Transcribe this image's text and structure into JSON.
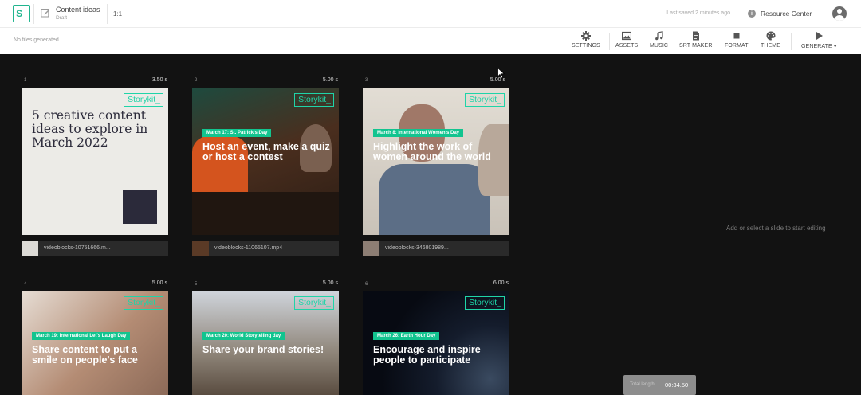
{
  "app": {
    "logo": "S_",
    "project_title": "Content ideas",
    "project_status": "Draft",
    "aspect_ratio": "1:1",
    "last_saved": "Last saved 2 minutes ago",
    "resource_center": "Resource Center"
  },
  "toolbar": {
    "status": "No files generated",
    "settings": "SETTINGS",
    "assets": "ASSETS",
    "music": "MUSIC",
    "srt_maker": "SRT MAKER",
    "format": "FORMAT",
    "theme": "THEME",
    "generate": "GENERATE"
  },
  "brand_label": "Storykit_",
  "slides": [
    {
      "num": "1",
      "duration": "3.50 s",
      "title": "5 creative content ideas to explore in March 2022",
      "file": "videoblocks-10751666.m..."
    },
    {
      "num": "2",
      "duration": "5.00 s",
      "tag": "March 17: St. Patrick's Day",
      "title": "Host an event, make a quiz or host a contest",
      "file": "videoblocks-11065107.mp4"
    },
    {
      "num": "3",
      "duration": "5.00 s",
      "tag": "March 8: International Women's Day",
      "title": "Highlight the work of women around the world",
      "file": "videoblocks-346801989..."
    },
    {
      "num": "4",
      "duration": "5.00 s",
      "tag": "March 19: International Let's Laugh Day",
      "title": "Share content to put a smile on people's face"
    },
    {
      "num": "5",
      "duration": "5.00 s",
      "tag": "March 20: World Storytelling day",
      "title": "Share your brand stories!"
    },
    {
      "num": "6",
      "duration": "6.00 s",
      "tag": "March 26: Earth Hour Day",
      "title": "Encourage and inspire people to participate"
    }
  ],
  "editor_hint": "Add or select a slide to start editing",
  "total": {
    "label": "Total length",
    "value": "00:34.50"
  },
  "colors": {
    "brand_green": "#1fd4a8",
    "tag_green": "#12c48f",
    "canvas_bg": "#121212"
  }
}
